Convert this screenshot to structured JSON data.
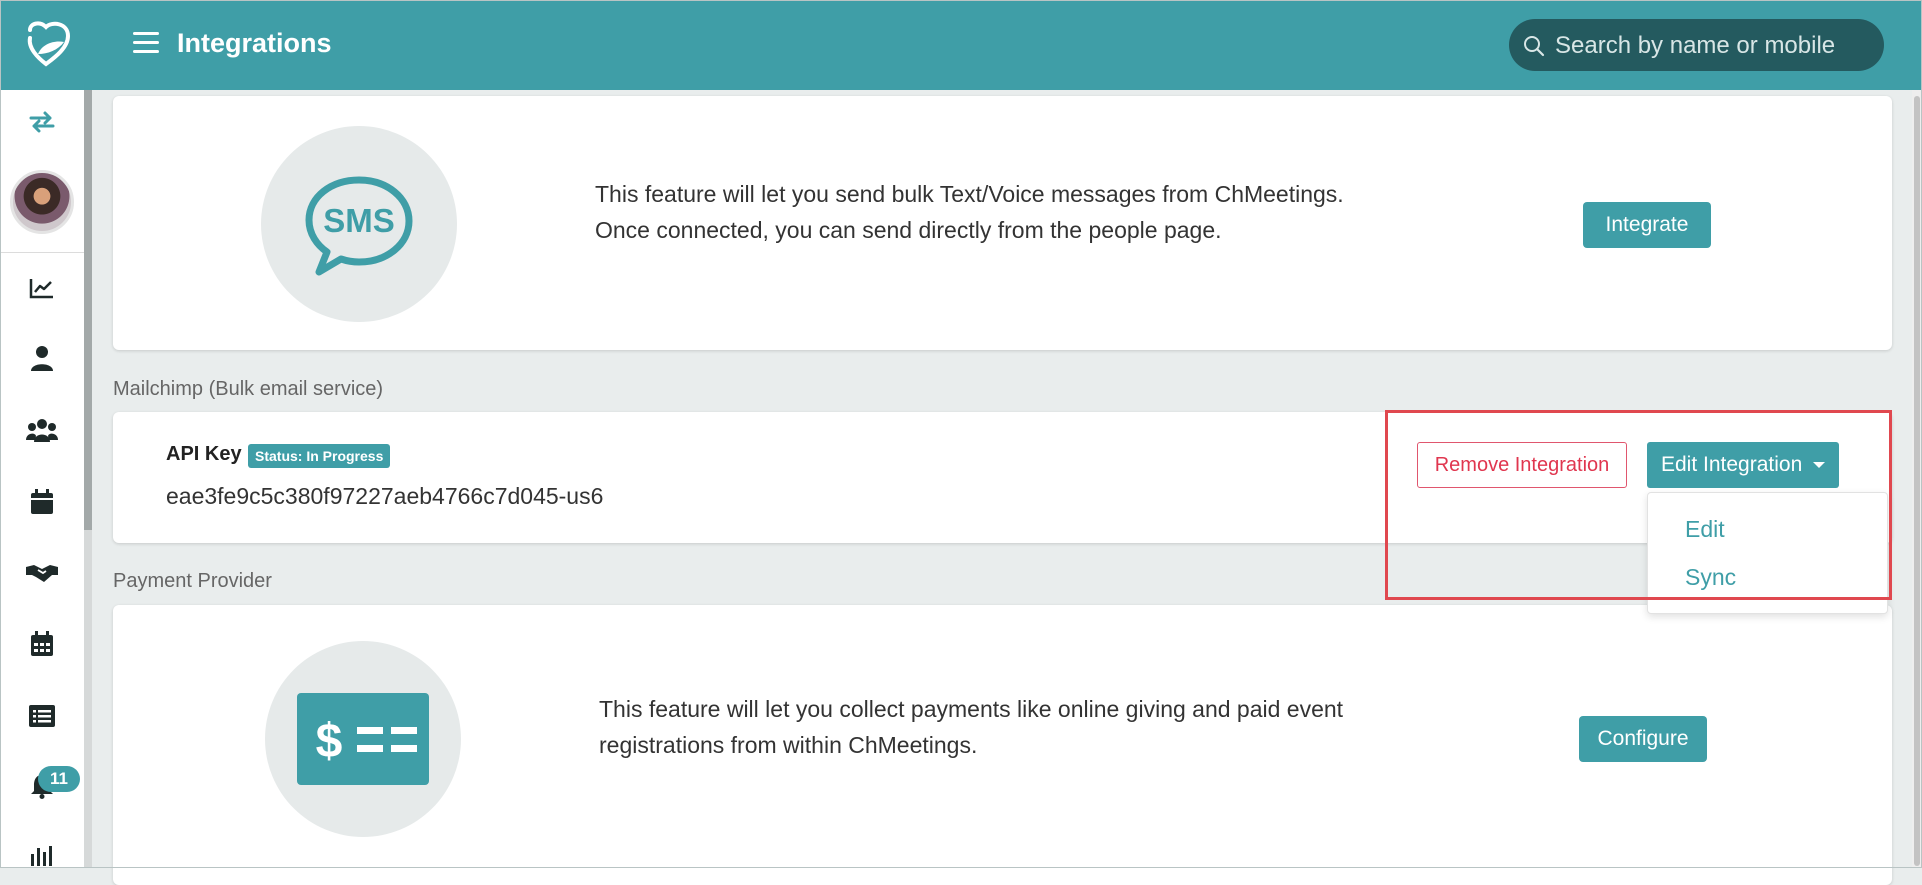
{
  "header": {
    "title": "Integrations",
    "search_placeholder": "Search by name or mobile"
  },
  "sidebar": {
    "items": [
      {
        "icon": "swap-arrows-icon"
      },
      {
        "icon": "avatar"
      },
      {
        "icon": "chart-line-icon"
      },
      {
        "icon": "person-icon"
      },
      {
        "icon": "group-icon"
      },
      {
        "icon": "calendar-icon"
      },
      {
        "icon": "handshake-icon"
      },
      {
        "icon": "calendar-grid-icon"
      },
      {
        "icon": "list-icon"
      },
      {
        "icon": "bell-icon"
      },
      {
        "icon": "bar-chart-icon"
      }
    ],
    "notification_count": "11"
  },
  "sms_card": {
    "icon_text": "SMS",
    "description_line1": "This feature will let you send bulk Text/Voice messages from ChMeetings.",
    "description_line2": "Once connected, you can send directly from the people page.",
    "button_label": "Integrate"
  },
  "mailchimp": {
    "section_label": "Mailchimp (Bulk email service)",
    "api_key_label": "API Key",
    "status_badge": "Status: In Progress",
    "api_key_value": "eae3fe9c5c380f97227aeb4766c7d045-us6",
    "remove_button": "Remove Integration",
    "edit_button": "Edit Integration",
    "dropdown": [
      "Edit",
      "Sync"
    ]
  },
  "payment": {
    "section_label": "Payment Provider",
    "icon_text": "$",
    "description_line1": "This feature will let you collect payments like online giving and paid event",
    "description_line2": "registrations from within ChMeetings.",
    "button_label": "Configure"
  },
  "colors": {
    "brand": "#3f9ea7",
    "danger": "#e0364f",
    "highlight": "#e0484f"
  }
}
